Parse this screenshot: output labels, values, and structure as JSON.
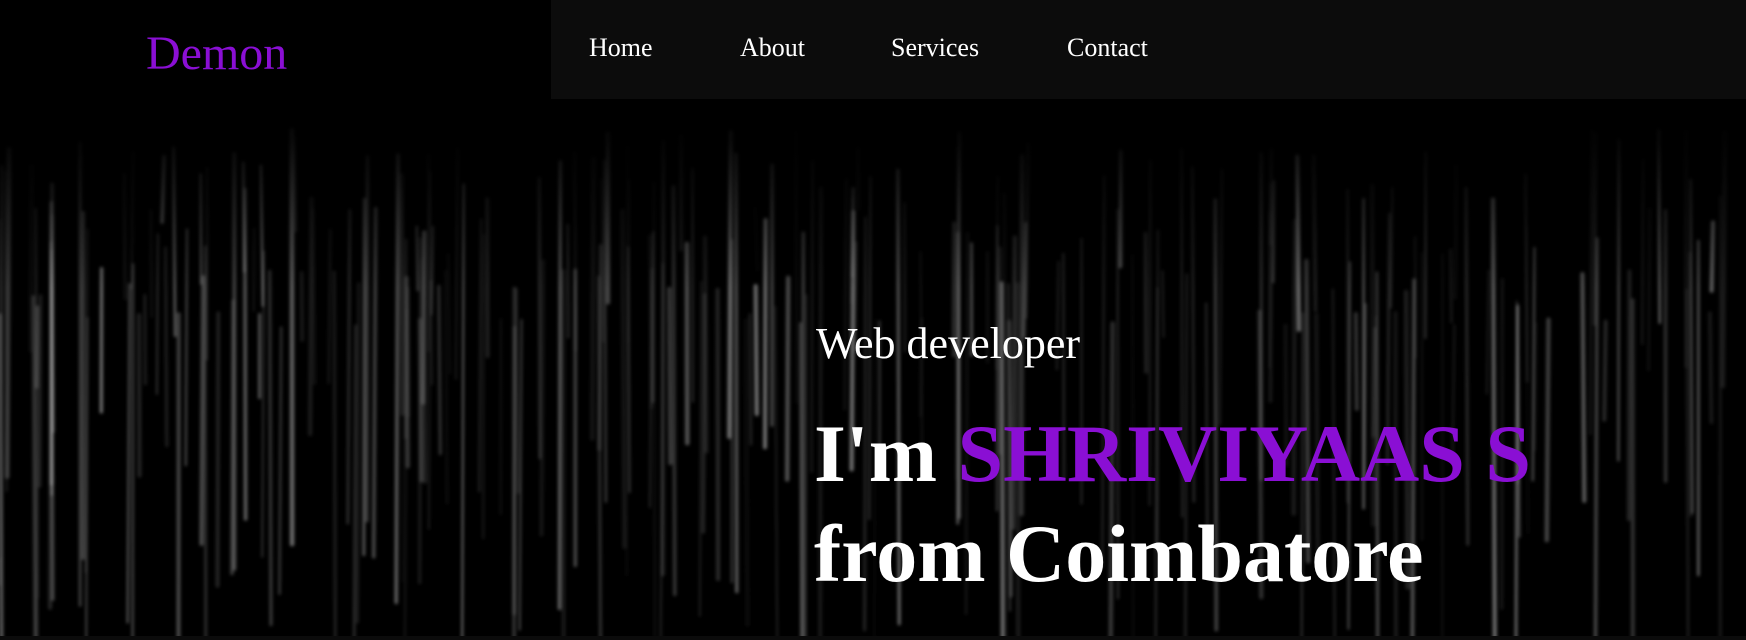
{
  "brand": {
    "logo_text": "Demon",
    "accent_color": "#8a0fd4"
  },
  "nav": {
    "items": [
      {
        "label": "Home"
      },
      {
        "label": "About"
      },
      {
        "label": "Services"
      },
      {
        "label": "Contact"
      }
    ]
  },
  "hero": {
    "subtitle": "Web developer",
    "greeting": "I'm",
    "name": "SHRIVIYAAS S",
    "location_line": "from Coimbatore",
    "background": "dark rain streaks"
  }
}
